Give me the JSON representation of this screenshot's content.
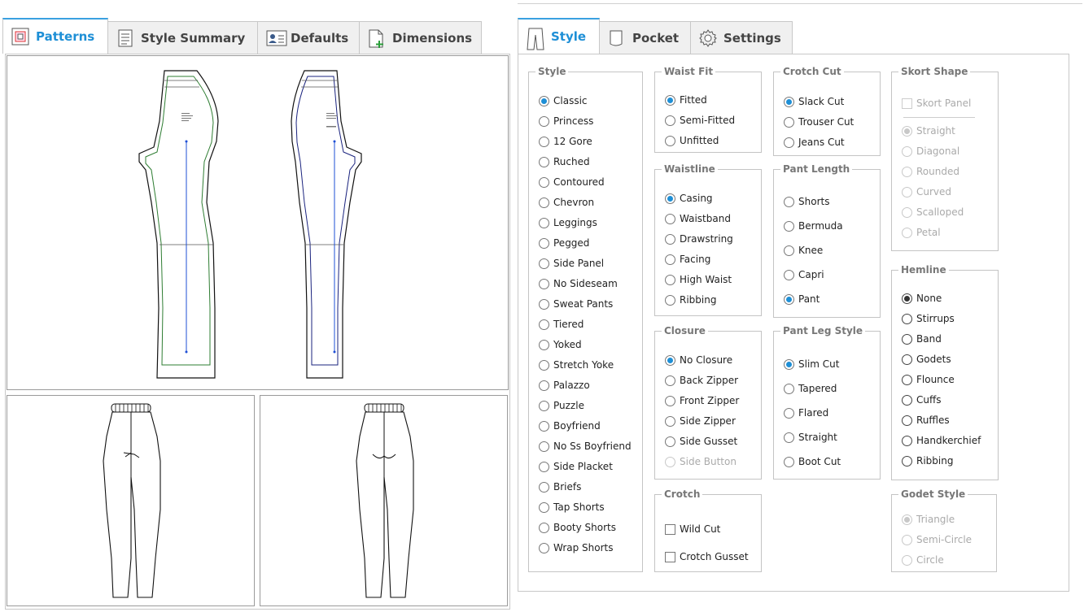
{
  "left_tabs": [
    {
      "label": "Patterns",
      "icon": "patterns-icon",
      "active": true
    },
    {
      "label": "Style Summary",
      "icon": "style-summary-icon",
      "active": false
    },
    {
      "label": "Defaults",
      "icon": "defaults-icon",
      "active": false
    },
    {
      "label": "Dimensions",
      "icon": "dimensions-icon",
      "active": false
    }
  ],
  "right_tabs": [
    {
      "label": "Style",
      "icon": "pants-icon",
      "active": true
    },
    {
      "label": "Pocket",
      "icon": "pocket-icon",
      "active": false
    },
    {
      "label": "Settings",
      "icon": "gear-icon",
      "active": false
    }
  ],
  "colors": {
    "accent": "#1e8fd6",
    "front_pattern": "#2e7d32",
    "back_pattern": "#1a237e",
    "grain": "#1e4fd6"
  },
  "groups": {
    "style": {
      "legend": "Style",
      "selected": 0,
      "options": [
        "Classic",
        "Princess",
        "12 Gore",
        "Ruched",
        "Contoured",
        "Chevron",
        "Leggings",
        "Pegged",
        "Side Panel",
        "No Sideseam",
        "Sweat Pants",
        "Tiered",
        "Yoked",
        "Stretch Yoke",
        "Palazzo",
        "Puzzle",
        "Boyfriend",
        "No Ss Boyfriend",
        "Side Placket",
        "Briefs",
        "Tap Shorts",
        "Booty Shorts",
        "Wrap Shorts"
      ]
    },
    "waist_fit": {
      "legend": "Waist Fit",
      "selected": 0,
      "options": [
        "Fitted",
        "Semi-Fitted",
        "Unfitted"
      ]
    },
    "waistline": {
      "legend": "Waistline",
      "selected": 0,
      "options": [
        "Casing",
        "Waistband",
        "Drawstring",
        "Facing",
        "High Waist",
        "Ribbing"
      ]
    },
    "closure": {
      "legend": "Closure",
      "selected": 0,
      "options": [
        "No Closure",
        "Back Zipper",
        "Front Zipper",
        "Side Zipper",
        "Side Gusset",
        "Side Button"
      ],
      "disabled": [
        5
      ]
    },
    "crotch": {
      "legend": "Crotch",
      "checkboxes": [
        "Wild Cut",
        "Crotch Gusset"
      ]
    },
    "crotch_cut": {
      "legend": "Crotch Cut",
      "selected": 0,
      "options": [
        "Slack Cut",
        "Trouser Cut",
        "Jeans Cut"
      ]
    },
    "pant_length": {
      "legend": "Pant Length",
      "selected": 4,
      "options": [
        "Shorts",
        "Bermuda",
        "Knee",
        "Capri",
        "Pant"
      ]
    },
    "pant_leg_style": {
      "legend": "Pant Leg Style",
      "selected": 0,
      "options": [
        "Slim Cut",
        "Tapered",
        "Flared",
        "Straight",
        "Boot Cut"
      ]
    },
    "skort_shape": {
      "legend": "Skort Shape",
      "checkbox": "Skort Panel",
      "selected": 0,
      "options": [
        "Straight",
        "Diagonal",
        "Rounded",
        "Curved",
        "Scalloped",
        "Petal"
      ]
    },
    "hemline": {
      "legend": "Hemline",
      "selected": 0,
      "options": [
        "None",
        "Stirrups",
        "Band",
        "Godets",
        "Flounce",
        "Cuffs",
        "Ruffles",
        "Handkerchief",
        "Ribbing"
      ]
    },
    "godet_style": {
      "legend": "Godet Style",
      "selected": 0,
      "options": [
        "Triangle",
        "Semi-Circle",
        "Circle"
      ]
    }
  }
}
